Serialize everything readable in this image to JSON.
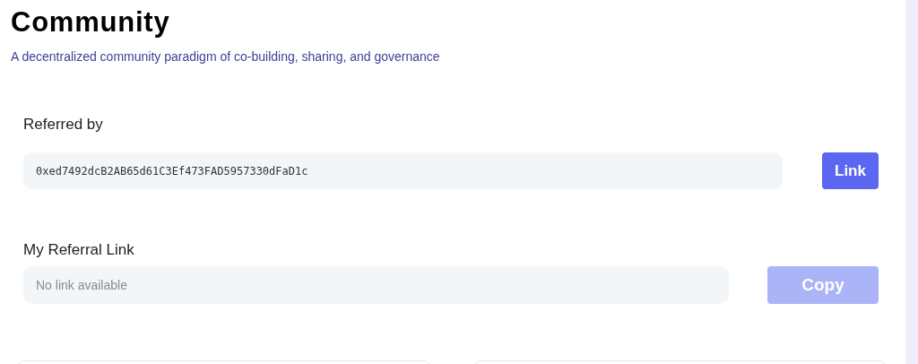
{
  "header": {
    "title": "Community",
    "subtitle": "A decentralized community paradigm of co-building, sharing, and governance"
  },
  "referred_by": {
    "label": "Referred by",
    "value": "0xed7492dcB2AB65d61C3Ef473FAD5957330dFaD1c",
    "button": {
      "label": "Link",
      "disabled": false
    }
  },
  "my_referral_link": {
    "label": "My Referral Link",
    "placeholder": "No link available",
    "button": {
      "label": "Copy",
      "disabled": true
    }
  }
}
